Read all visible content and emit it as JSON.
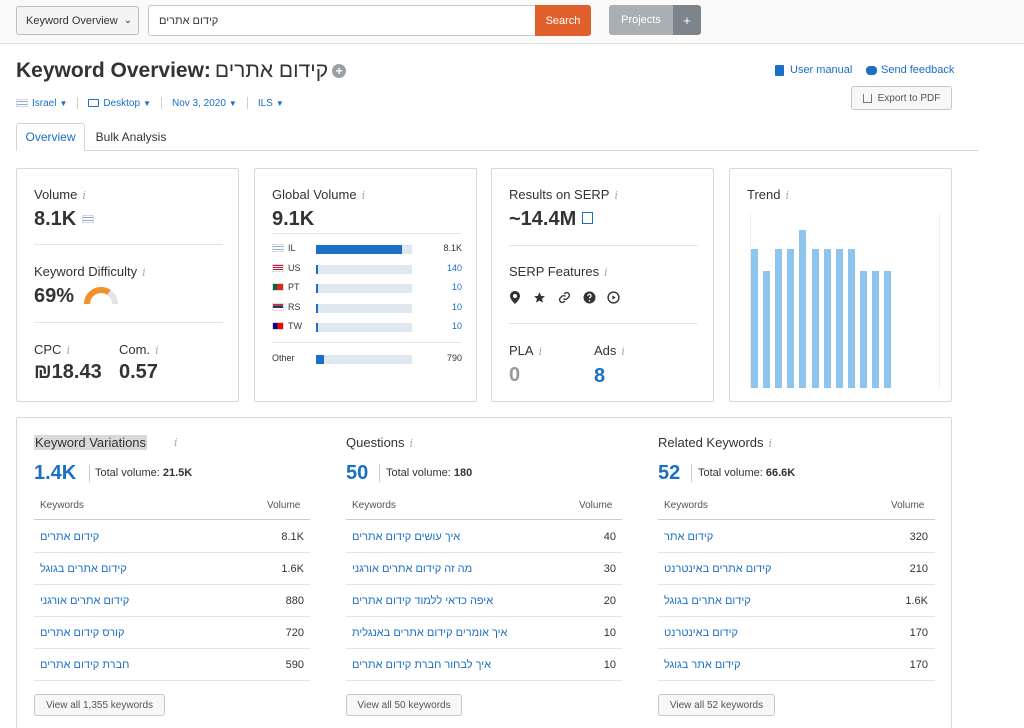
{
  "toolbar": {
    "tool_select": "Keyword Overview",
    "search_value": "קידום אתרים",
    "search_button": "Search",
    "projects_button": "Projects",
    "projects_plus": "+"
  },
  "header": {
    "title": "Keyword Overview:",
    "keyword": "קידום אתרים",
    "user_manual": "User manual",
    "send_feedback": "Send feedback",
    "export_pdf": "Export to PDF"
  },
  "filters": {
    "country": "Israel",
    "device": "Desktop",
    "date": "Nov 3, 2020",
    "currency": "ILS"
  },
  "tabs": [
    "Overview",
    "Bulk Analysis"
  ],
  "volume": {
    "label": "Volume",
    "value": "8.1K",
    "kd_label": "Keyword Difficulty",
    "kd_value": "69%",
    "kd_fraction": 0.69,
    "cpc_label": "CPC",
    "cpc_value": "₪18.43",
    "com_label": "Com.",
    "com_value": "0.57"
  },
  "global_volume": {
    "label": "Global Volume",
    "value": "9.1K",
    "rows": [
      {
        "code": "IL",
        "value": "8.1K",
        "fraction": 0.9
      },
      {
        "code": "US",
        "value": "140",
        "fraction": 0.02
      },
      {
        "code": "PT",
        "value": "10",
        "fraction": 0.01
      },
      {
        "code": "RS",
        "value": "10",
        "fraction": 0.01
      },
      {
        "code": "TW",
        "value": "10",
        "fraction": 0.01
      }
    ],
    "other_label": "Other",
    "other_value": "790",
    "other_fraction": 0.08
  },
  "serp": {
    "label": "Results on SERP",
    "value": "~14.4M",
    "features_label": "SERP Features",
    "features_icons": [
      "location-pin-icon",
      "star-icon",
      "link-icon",
      "question-icon",
      "play-icon"
    ],
    "pla_label": "PLA",
    "pla_value": "0",
    "ads_label": "Ads",
    "ads_value": "8"
  },
  "trend": {
    "label": "Trend",
    "values": [
      0.8,
      0.67,
      0.8,
      0.8,
      0.91,
      0.8,
      0.8,
      0.8,
      0.8,
      0.67,
      0.67,
      0.67
    ]
  },
  "colors": {
    "accent": "#1a6fc6",
    "search_button": "#e0602c",
    "trend_bar": "#8ec5ef",
    "kd_gauge": "#f2902d"
  },
  "variations": {
    "title": "Keyword Variations",
    "count": "1.4K",
    "total_label": "Total volume:",
    "total_value": "21.5K",
    "col_keywords": "Keywords",
    "col_volume": "Volume",
    "rows": [
      {
        "kw": "קידום אתרים",
        "vol": "8.1K"
      },
      {
        "kw": "קידום אתרים בגוגל",
        "vol": "1.6K"
      },
      {
        "kw": "קידום אתרים אורגני",
        "vol": "880"
      },
      {
        "kw": "קורס קידום אתרים",
        "vol": "720"
      },
      {
        "kw": "חברת קידום אתרים",
        "vol": "590"
      }
    ],
    "view_all": "View all 1,355 keywords"
  },
  "questions": {
    "title": "Questions",
    "count": "50",
    "total_label": "Total volume:",
    "total_value": "180",
    "col_keywords": "Keywords",
    "col_volume": "Volume",
    "rows": [
      {
        "kw": "איך עושים קידום אתרים",
        "vol": "40"
      },
      {
        "kw": "מה זה קידום אתרים אורגני",
        "vol": "30"
      },
      {
        "kw": "איפה כדאי ללמוד קידום אתרים",
        "vol": "20"
      },
      {
        "kw": "איך אומרים קידום אתרים באנגלית",
        "vol": "10"
      },
      {
        "kw": "איך לבחור חברת קידום אתרים",
        "vol": "10"
      }
    ],
    "view_all": "View all 50 keywords"
  },
  "related": {
    "title": "Related Keywords",
    "count": "52",
    "total_label": "Total volume:",
    "total_value": "66.6K",
    "col_keywords": "Keywords",
    "col_volume": "Volume",
    "rows": [
      {
        "kw": "קידום אתר",
        "vol": "320"
      },
      {
        "kw": "קידום אתרים באינטרנט",
        "vol": "210"
      },
      {
        "kw": "קידום אתרים בגוגל",
        "vol": "1.6K"
      },
      {
        "kw": "קידום באינטרנט",
        "vol": "170"
      },
      {
        "kw": "קידום אתר בגוגל",
        "vol": "170"
      }
    ],
    "view_all": "View all 52 keywords"
  }
}
